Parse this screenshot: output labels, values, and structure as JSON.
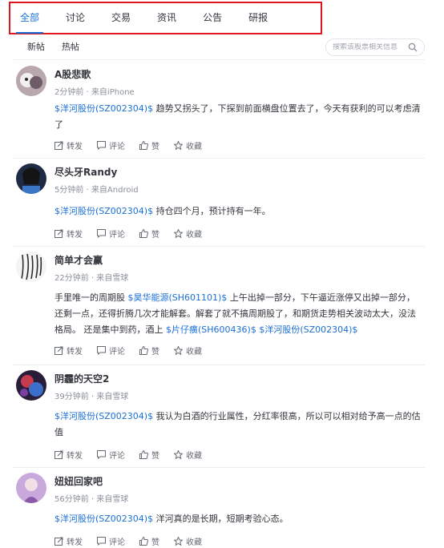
{
  "tabs": [
    "全部",
    "讨论",
    "交易",
    "资讯",
    "公告",
    "研报"
  ],
  "subtabs": [
    "新帖",
    "热帖"
  ],
  "search": {
    "placeholder": "搜索该股票相关信息"
  },
  "action_labels": {
    "repost": "转发",
    "comment": "评论",
    "like": "赞",
    "favorite": "收藏"
  },
  "meta_separator": "·",
  "posts": [
    {
      "user": "A股悲歌",
      "time": "2分钟前",
      "source": "来自iPhone",
      "segments": [
        {
          "text": "$洋河股份(SZ002304)$",
          "link": true
        },
        {
          "text": " 趋势又拐头了，下探到前面横盘位置去了，今天有获利的可以考虑清了",
          "link": false
        }
      ]
    },
    {
      "user": "尽头牙Randy",
      "time": "5分钟前",
      "source": "来自Android",
      "segments": [
        {
          "text": "$洋河股份(SZ002304)$",
          "link": true
        },
        {
          "text": " 持仓四个月，预计持有一年。",
          "link": false
        }
      ]
    },
    {
      "user": "简单才会赢",
      "time": "22分钟前",
      "source": "来自雪球",
      "segments": [
        {
          "text": "手里唯一的周期股 ",
          "link": false
        },
        {
          "text": "$昊华能源(SH601101)$",
          "link": true
        },
        {
          "text": " 上午出掉一部分，下午逼近涨停又出掉一部分，还剩一点，还得折腾几次才能解套。解套了就不搞周期股了，和期货走势相关波动太大，没法格局。 还是集中到药，酒上 ",
          "link": false
        },
        {
          "text": "$片仔癀(SH600436)$",
          "link": true
        },
        {
          "text": "  ",
          "link": false
        },
        {
          "text": "$洋河股份(SZ002304)$",
          "link": true
        }
      ]
    },
    {
      "user": "阴霾的天空2",
      "time": "39分钟前",
      "source": "来自雪球",
      "segments": [
        {
          "text": "$洋河股份(SZ002304)$",
          "link": true
        },
        {
          "text": " 我认为白酒的行业属性，分红率很高，所以可以相对给予高一点的估值",
          "link": false
        }
      ]
    },
    {
      "user": "妞妞回家吧",
      "time": "56分钟前",
      "source": "来自雪球",
      "segments": [
        {
          "text": "$洋河股份(SZ002304)$",
          "link": true
        },
        {
          "text": " 洋河真的是长期，短期考验心态。",
          "link": false
        }
      ]
    }
  ]
}
